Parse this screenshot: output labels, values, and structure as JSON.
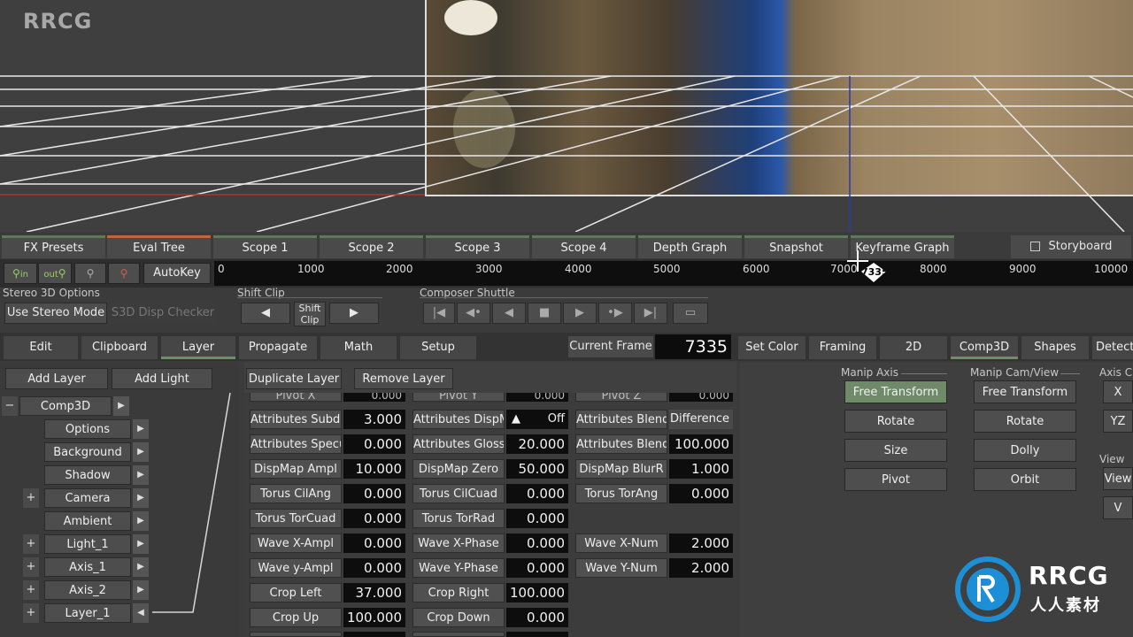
{
  "watermark": "RRCG",
  "viewer_tabs": [
    {
      "label": "FX Presets"
    },
    {
      "label": "Eval Tree"
    },
    {
      "label": "Scope 1"
    },
    {
      "label": "Scope 2"
    },
    {
      "label": "Scope 3"
    },
    {
      "label": "Scope 4"
    },
    {
      "label": "Depth Graph"
    },
    {
      "label": "Snapshot"
    },
    {
      "label": "Keyframe Graph"
    }
  ],
  "storyboard": "Storyboard",
  "timeline": {
    "in_label": "in",
    "out_label": "out",
    "autokey": "AutoKey",
    "ticks": [
      "0",
      "1000",
      "2000",
      "3000",
      "4000",
      "5000",
      "6000",
      "7000",
      "8000",
      "9000",
      "10000"
    ],
    "marker": "7335"
  },
  "stereo": {
    "section": "Stereo 3D Options",
    "use_stereo": "Use Stereo Mode",
    "checker": "S3D Disp Checker"
  },
  "shift_clip": {
    "section": "Shift Clip",
    "label_line1": "Shift",
    "label_line2": "Clip"
  },
  "composer_shuttle": {
    "section": "Composer Shuttle"
  },
  "menu": {
    "left_tabs": [
      "Edit",
      "Clipboard",
      "Layer",
      "Propagate",
      "Math",
      "Setup"
    ],
    "current_frame_label": "Current Frame",
    "current_frame_value": "7335",
    "right_tabs": [
      "Set Color",
      "Framing",
      "2D",
      "Comp3D",
      "Shapes",
      "Detect"
    ]
  },
  "layer_actions": {
    "add_layer": "Add Layer",
    "add_light": "Add Light",
    "duplicate": "Duplicate Layer",
    "remove": "Remove Layer"
  },
  "tree": {
    "root": "Comp3D",
    "items": [
      "Options",
      "Background",
      "Shadow",
      "Camera",
      "Ambient",
      "Light_1",
      "Axis_1",
      "Axis_2",
      "Layer_1"
    ]
  },
  "attributes": {
    "header": [
      "Pivot X",
      "0.000",
      "Pivot Y",
      "0.000",
      "Pivot Z",
      "0.000"
    ],
    "rows": [
      [
        [
          "Attributes Subdiv",
          "3.000"
        ],
        [
          "Attributes DispMa",
          "Off"
        ],
        [
          "Attributes Blendin",
          "Difference"
        ]
      ],
      [
        [
          "Attributes Specula",
          "0.000"
        ],
        [
          "Attributes Gloss",
          "20.000"
        ],
        [
          "Attributes Blend",
          "100.000"
        ]
      ],
      [
        [
          "DispMap Ampl",
          "10.000"
        ],
        [
          "DispMap Zero",
          "50.000"
        ],
        [
          "DispMap BlurR",
          "1.000"
        ]
      ],
      [
        [
          "Torus CilAng",
          "0.000"
        ],
        [
          "Torus CilCuad",
          "0.000"
        ],
        [
          "Torus TorAng",
          "0.000"
        ]
      ],
      [
        [
          "Torus TorCuad",
          "0.000"
        ],
        [
          "Torus TorRad",
          "0.000"
        ],
        null
      ],
      [
        [
          "Wave X-Ampl",
          "0.000"
        ],
        [
          "Wave X-Phase",
          "0.000"
        ],
        [
          "Wave X-Num",
          "2.000"
        ]
      ],
      [
        [
          "Wave y-Ampl",
          "0.000"
        ],
        [
          "Wave Y-Phase",
          "0.000"
        ],
        [
          "Wave Y-Num",
          "2.000"
        ]
      ],
      [
        [
          "Crop Left",
          "37.000"
        ],
        [
          "Crop Right",
          "100.000"
        ],
        null
      ],
      [
        [
          "Crop Up",
          "100.000"
        ],
        [
          "Crop Down",
          "0.000"
        ],
        null
      ]
    ]
  },
  "manip_axis": {
    "section": "Manip Axis",
    "buttons": [
      "Free Transform",
      "Rotate",
      "Size",
      "Pivot"
    ]
  },
  "manip_cam": {
    "section": "Manip Cam/View",
    "buttons": [
      "Free Transform",
      "Rotate",
      "Dolly",
      "Orbit"
    ]
  },
  "axis_section": {
    "section": "Axis C",
    "buttons": [
      "X",
      "YZ"
    ]
  },
  "view_section": {
    "section": "View",
    "buttons": [
      "View",
      "V"
    ]
  },
  "logo": {
    "text": "RRCG",
    "sub": "人人素材"
  },
  "colors": {
    "active_tab": "#c0663a",
    "active_button": "#6f8a68",
    "tab_stripe": "#5d7a5a",
    "logo_blue": "#1d8fd6"
  }
}
